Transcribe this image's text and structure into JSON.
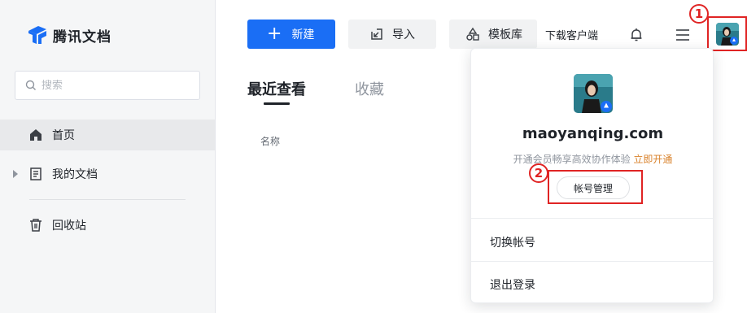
{
  "app": {
    "name": "腾讯文档",
    "brand_color": "#1a6ef5"
  },
  "sidebar": {
    "search_placeholder": "搜索",
    "items": [
      {
        "label": "首页",
        "icon": "home-icon",
        "active": true
      },
      {
        "label": "我的文档",
        "icon": "document-icon",
        "expandable": true
      },
      {
        "label": "回收站",
        "icon": "trash-icon"
      }
    ]
  },
  "toolbar": {
    "new_label": "新建",
    "import_label": "导入",
    "template_label": "模板库",
    "download_label": "下载客户端"
  },
  "tabs": [
    {
      "label": "最近查看",
      "active": true
    },
    {
      "label": "收藏",
      "active": false
    }
  ],
  "list": {
    "column_name": "名称"
  },
  "account_menu": {
    "username": "maoyanqing.com",
    "promo_text": "开通会员畅享高效协作体验",
    "promo_link": "立即开通",
    "account_button": "帐号管理",
    "items": [
      "切换帐号",
      "退出登录"
    ]
  },
  "annotations": {
    "step1": "1",
    "step2": "2",
    "highlight_color": "#e02424"
  }
}
